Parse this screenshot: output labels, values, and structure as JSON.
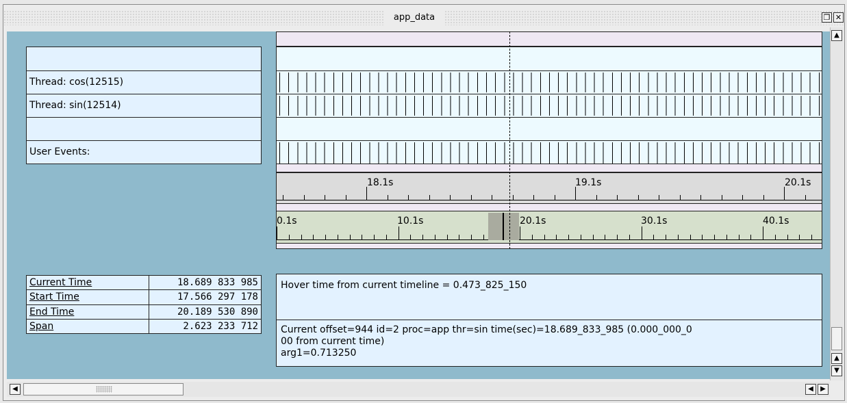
{
  "window": {
    "title": "app_data"
  },
  "event_rows": [
    {
      "label": ""
    },
    {
      "label": "Thread: cos(12515)"
    },
    {
      "label": "Thread: sin(12514)"
    },
    {
      "label": ""
    },
    {
      "label": "User Events:"
    }
  ],
  "ruler_zoom": {
    "labels": [
      "18.1s",
      "19.1s",
      "20.1s"
    ]
  },
  "ruler_overview": {
    "labels": [
      "0.1s",
      "10.1s",
      "20.1s",
      "30.1s",
      "40.1s"
    ]
  },
  "time_info": [
    {
      "label": "Current Time",
      "value": "18.689 833 985"
    },
    {
      "label": "Start Time",
      "value": "17.566 297 178"
    },
    {
      "label": "End Time",
      "value": "20.189 530 890"
    },
    {
      "label": "Span",
      "value": "2.623 233 712"
    }
  ],
  "hover": {
    "text": "Hover time from current timeline = 0.473_825_150"
  },
  "detail": {
    "line1": "Current offset=944  id=2  proc=app  thr=sin  time(sec)=18.689_833_985  (0.000_000_0",
    "line2": "00 from current time)",
    "line3": "arg1=0.713250"
  },
  "icons": {
    "restore": "restore-window-icon",
    "close": "close-icon",
    "scroll_up": "arrow-up-icon",
    "scroll_down": "arrow-down-icon",
    "scroll_left": "arrow-left-icon",
    "scroll_right": "arrow-right-icon"
  },
  "colors": {
    "background": "#8fbacc",
    "label_panel": "#e3f2ff",
    "timeline_rows": "#edfaff",
    "zoom_ruler": "#dcdcdc",
    "overview_ruler": "#d6e0cc"
  }
}
